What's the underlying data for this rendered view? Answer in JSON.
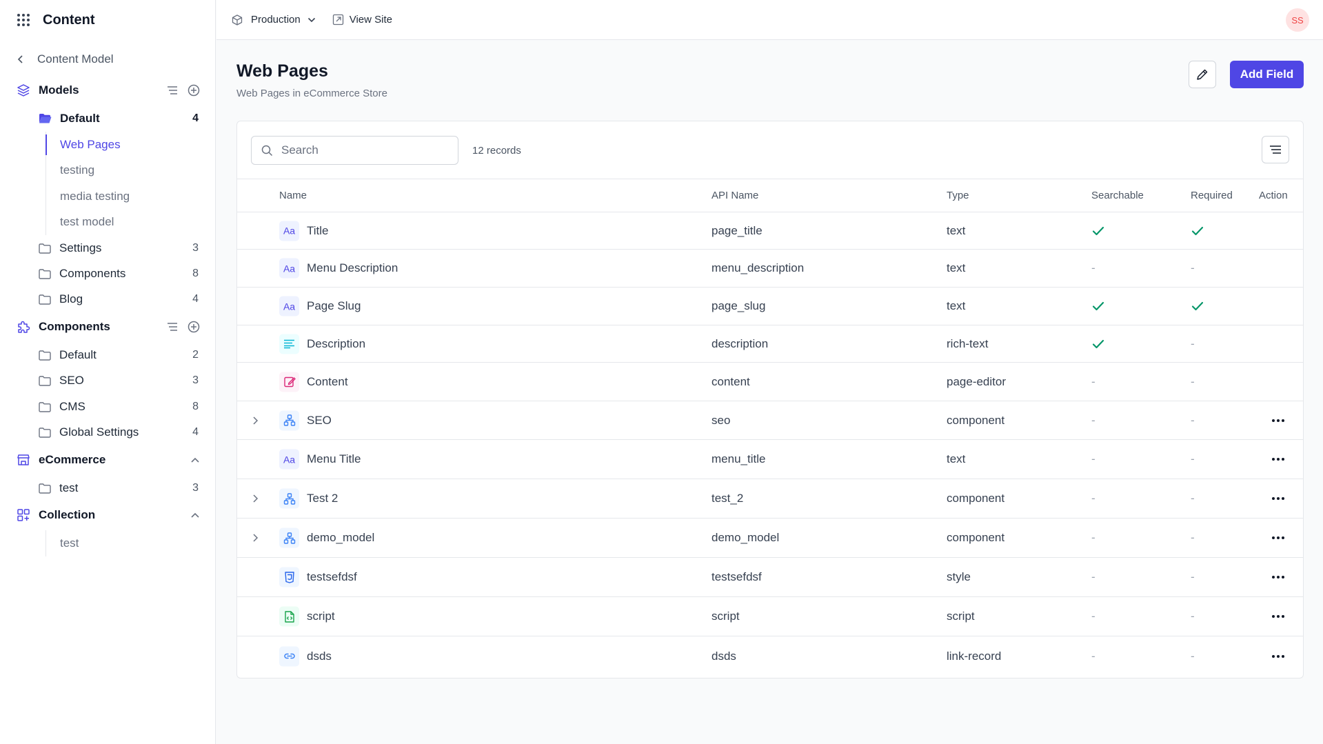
{
  "app": {
    "title": "Content"
  },
  "topbar": {
    "environment": "Production",
    "view_site": "View Site",
    "avatar_initials": "SS"
  },
  "sidebar": {
    "back_label": "Content Model",
    "models": {
      "label": "Models",
      "folders": [
        {
          "label": "Default",
          "count": "4",
          "active": true,
          "children": [
            {
              "label": "Web Pages",
              "active": true
            },
            {
              "label": "testing"
            },
            {
              "label": "media testing"
            },
            {
              "label": "test model"
            }
          ]
        },
        {
          "label": "Settings",
          "count": "3"
        },
        {
          "label": "Components",
          "count": "8"
        },
        {
          "label": "Blog",
          "count": "4"
        }
      ]
    },
    "components": {
      "label": "Components",
      "folders": [
        {
          "label": "Default",
          "count": "2"
        },
        {
          "label": "SEO",
          "count": "3"
        },
        {
          "label": "CMS",
          "count": "8"
        },
        {
          "label": "Global Settings",
          "count": "4"
        }
      ]
    },
    "ecommerce": {
      "label": "eCommerce",
      "folders": [
        {
          "label": "test",
          "count": "3"
        }
      ]
    },
    "collection": {
      "label": "Collection",
      "children": [
        {
          "label": "test"
        }
      ]
    }
  },
  "page": {
    "title": "Web Pages",
    "subtitle": "Web Pages in eCommerce Store",
    "add_button": "Add Field"
  },
  "table": {
    "search_placeholder": "Search",
    "records_count": "12 records",
    "columns": {
      "name": "Name",
      "api": "API Name",
      "type": "Type",
      "searchable": "Searchable",
      "required": "Required",
      "action": "Action"
    },
    "dash": "-",
    "rows": [
      {
        "icon": "text-icon",
        "name": "Title",
        "api": "page_title",
        "type": "text",
        "searchable": true,
        "required": true,
        "expandable": false,
        "action": false
      },
      {
        "icon": "text-icon",
        "name": "Menu Description",
        "api": "menu_description",
        "type": "text",
        "searchable": false,
        "required": false,
        "expandable": false,
        "action": false
      },
      {
        "icon": "text-icon",
        "name": "Page Slug",
        "api": "page_slug",
        "type": "text",
        "searchable": true,
        "required": true,
        "expandable": false,
        "action": false
      },
      {
        "icon": "rich-text-icon",
        "name": "Description",
        "api": "description",
        "type": "rich-text",
        "searchable": true,
        "required": false,
        "expandable": false,
        "action": false
      },
      {
        "icon": "page-editor-icon",
        "name": "Content",
        "api": "content",
        "type": "page-editor",
        "searchable": false,
        "required": false,
        "expandable": false,
        "action": false
      },
      {
        "icon": "component-icon",
        "name": "SEO",
        "api": "seo",
        "type": "component",
        "searchable": false,
        "required": false,
        "expandable": true,
        "action": true
      },
      {
        "icon": "text-icon",
        "name": "Menu Title",
        "api": "menu_title",
        "type": "text",
        "searchable": false,
        "required": false,
        "expandable": false,
        "action": true
      },
      {
        "icon": "component-icon",
        "name": "Test 2",
        "api": "test_2",
        "type": "component",
        "searchable": false,
        "required": false,
        "expandable": true,
        "action": true
      },
      {
        "icon": "component-icon",
        "name": "demo_model",
        "api": "demo_model",
        "type": "component",
        "searchable": false,
        "required": false,
        "expandable": true,
        "action": true
      },
      {
        "icon": "style-icon",
        "name": "testsefdsf",
        "api": "testsefdsf",
        "type": "style",
        "searchable": false,
        "required": false,
        "expandable": false,
        "action": true
      },
      {
        "icon": "script-icon",
        "name": "script",
        "api": "script",
        "type": "script",
        "searchable": false,
        "required": false,
        "expandable": false,
        "action": true
      },
      {
        "icon": "link-record-icon",
        "name": "dsds",
        "api": "dsds",
        "type": "link-record",
        "searchable": false,
        "required": false,
        "expandable": false,
        "action": true
      }
    ]
  },
  "icons": {
    "text_glyph": "Aa"
  },
  "colors": {
    "accent": "#4f46e5",
    "check": "#059669"
  }
}
